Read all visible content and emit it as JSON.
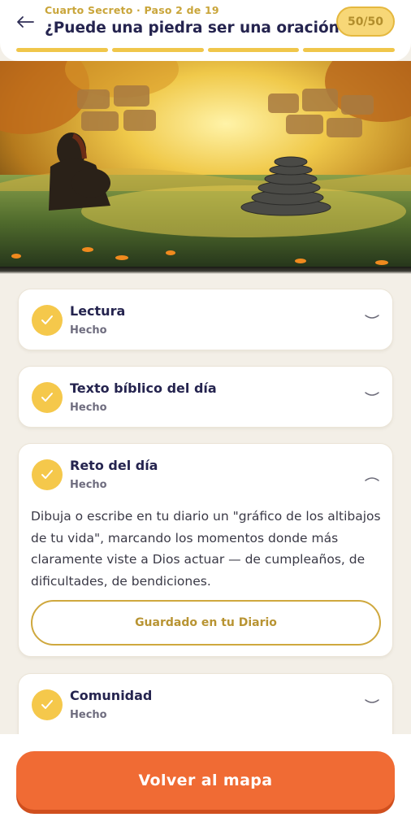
{
  "header": {
    "kicker": "Cuarto Secreto · Paso 2 de 19",
    "title": "¿Puede una piedra ser una oración?",
    "score": "50/50",
    "progress_segments": 4,
    "accent_color": "#f0c64a"
  },
  "hero": {
    "icon": "illustration-stone-cairn"
  },
  "sections": [
    {
      "title": "Lectura",
      "status": "Hecho",
      "expanded": false
    },
    {
      "title": "Texto bíblico del día",
      "status": "Hecho",
      "expanded": false
    },
    {
      "title": "Reto del día",
      "status": "Hecho",
      "expanded": true,
      "body": "Dibuja o escribe en tu diario un \"gráfico de los altibajos de tu vida\", marcando los momentos donde más claramente viste a Dios actuar — de cumpleaños, de dificultades, de bendiciones.",
      "action_label": "Guardado en tu Diario"
    },
    {
      "title": "Comunidad",
      "status": "Hecho",
      "expanded": false
    }
  ],
  "footer": {
    "primary_label": "Volver al mapa",
    "primary_color": "#f06b34"
  }
}
